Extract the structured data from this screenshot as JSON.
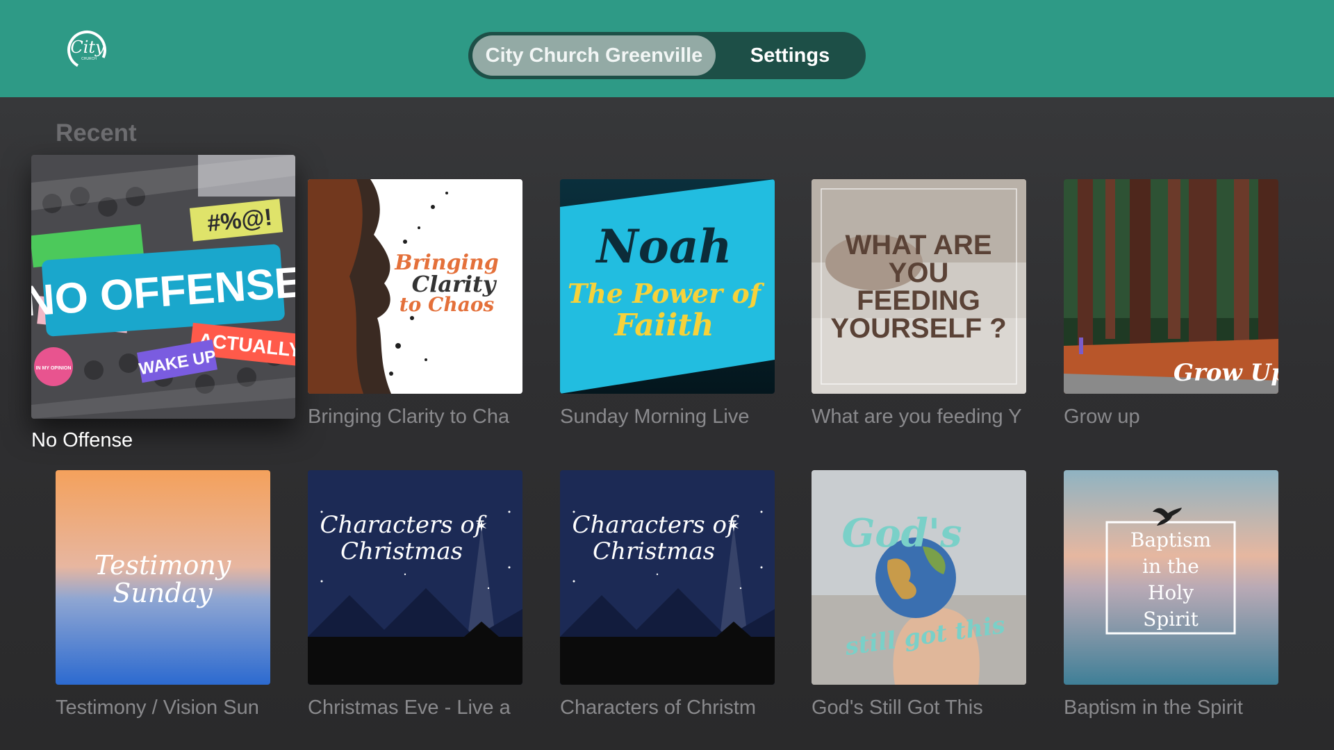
{
  "header": {
    "logo_icon": "city-church-logo",
    "tabs": [
      {
        "label": "City Church Greenville",
        "selected": true
      },
      {
        "label": "Settings",
        "selected": false
      }
    ]
  },
  "section": {
    "title": "Recent"
  },
  "items": [
    {
      "label": "No Offense",
      "focused": true,
      "art_lines": [
        "NO OFFENSE",
        "#%@!",
        "ACTUALLY",
        "WAKE UP",
        "IN MY OPINION"
      ]
    },
    {
      "label": "Bringing Clarity to Cha",
      "art_lines": [
        "Bringing",
        "Clarity",
        "to Chaos"
      ]
    },
    {
      "label": "Sunday Morning Live",
      "art_lines": [
        "Noah",
        "The Power of",
        "Faiith"
      ]
    },
    {
      "label": "What are you feeding Y",
      "art_lines": [
        "WHAT ARE",
        "YOU",
        "FEEDING",
        "YOURSELF ?"
      ]
    },
    {
      "label": "Grow up",
      "art_lines": [
        "Grow Up"
      ]
    },
    {
      "label": "Testimony / Vision Sun",
      "art_lines": [
        "Testimony",
        "Sunday"
      ]
    },
    {
      "label": "Christmas Eve - Live a",
      "art_lines": [
        "Characters of",
        "Christmas"
      ]
    },
    {
      "label": "Characters of Christm",
      "art_lines": [
        "Characters of",
        "Christmas"
      ]
    },
    {
      "label": "God's Still Got This",
      "art_lines": [
        "God's",
        "still got this"
      ]
    },
    {
      "label": "Baptism in the Spirit",
      "art_lines": [
        "Baptism",
        "in the",
        "Holy",
        "Spirit"
      ]
    }
  ],
  "colors": {
    "header_bg": "#2e9a86",
    "tab_active_bg": "#93aaa5",
    "tabs_bg": "#1d4f47",
    "page_bg": "#333335"
  }
}
